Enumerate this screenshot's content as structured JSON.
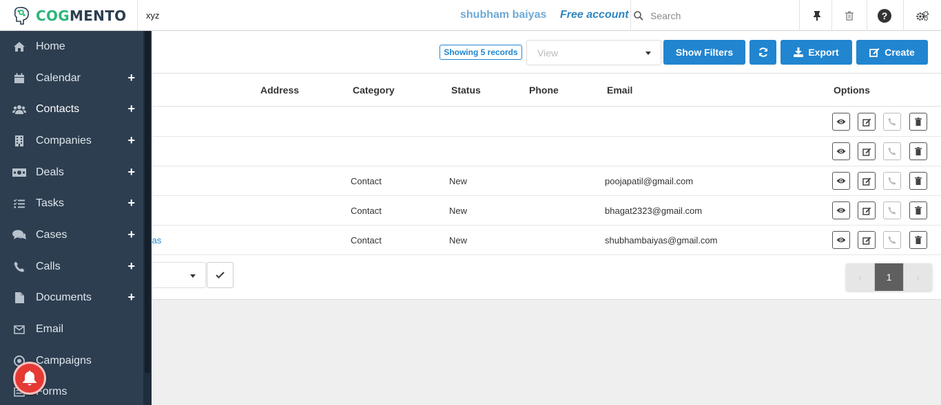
{
  "header": {
    "app_name_part1": "COG",
    "app_name_part2": "MENTO",
    "search_text": "xyz",
    "user_name": "shubham baiyas",
    "account_type": "Free account",
    "search_placeholder": "Search"
  },
  "sidebar": {
    "items": [
      {
        "label": "Home",
        "icon": "home-icon",
        "plus": ""
      },
      {
        "label": "Calendar",
        "icon": "calendar-icon",
        "plus": "+"
      },
      {
        "label": "Contacts",
        "icon": "users-icon",
        "plus": "+"
      },
      {
        "label": "Companies",
        "icon": "building-icon",
        "plus": "+"
      },
      {
        "label": "Deals",
        "icon": "money-icon",
        "plus": "+"
      },
      {
        "label": "Tasks",
        "icon": "tasks-icon",
        "plus": "+"
      },
      {
        "label": "Cases",
        "icon": "comments-icon",
        "plus": "+"
      },
      {
        "label": "Calls",
        "icon": "phone-icon",
        "plus": "+"
      },
      {
        "label": "Documents",
        "icon": "file-icon",
        "plus": "+"
      },
      {
        "label": "Email",
        "icon": "envelope-icon",
        "plus": ""
      },
      {
        "label": "Campaigns",
        "icon": "bullhorn-icon",
        "plus": ""
      },
      {
        "label": "Forms",
        "icon": "form-icon",
        "plus": ""
      }
    ]
  },
  "toolbar": {
    "records_badge": "Showing 5 records",
    "view_placeholder": "View",
    "show_filters": "Show Filters",
    "export": "Export",
    "create": "Create"
  },
  "table": {
    "columns": [
      "Address",
      "Category",
      "Status",
      "Phone",
      "Email",
      "Options"
    ],
    "rows": [
      {
        "name": "",
        "address": "",
        "category": "",
        "status": "",
        "phone": "",
        "email": ""
      },
      {
        "name": "",
        "address": "",
        "category": "",
        "status": "",
        "phone": "",
        "email": ""
      },
      {
        "name": "",
        "address": "",
        "category": "Contact",
        "status": "New",
        "phone": "",
        "email": "poojapatil@gmail.com"
      },
      {
        "name": "",
        "address": "",
        "category": "Contact",
        "status": "New",
        "phone": "",
        "email": "bhagat2323@gmail.com"
      },
      {
        "name": "yas",
        "address": "",
        "category": "Contact",
        "status": "New",
        "phone": "",
        "email": "shubhambaiyas@gmail.com"
      }
    ]
  },
  "pagination": {
    "prev": "‹",
    "current_page": "1",
    "next": "›"
  },
  "colors": {
    "primary": "#2185d0",
    "sidebar_bg": "#2d3e50",
    "logo_green": "#2eb57b",
    "notification_red": "#e53935"
  }
}
